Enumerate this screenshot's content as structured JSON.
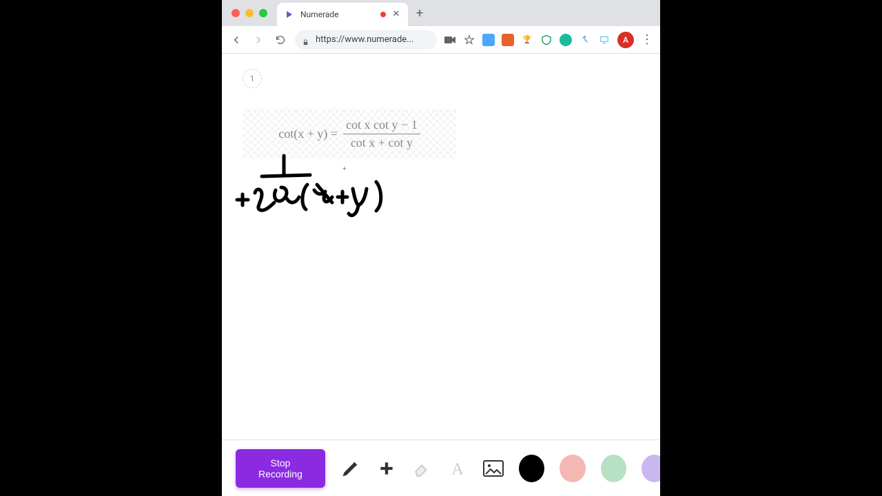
{
  "tab": {
    "title": "Numerade"
  },
  "address": {
    "url": "https://www.numerade..."
  },
  "avatar": {
    "letter": "A"
  },
  "page": {
    "badge": "1"
  },
  "formula": {
    "lhs": "cot(x + y) =",
    "num": "cot x cot y − 1",
    "den": "cot x + cot y"
  },
  "handwriting": {
    "numerator": "1",
    "denominator": "tan (x + y)"
  },
  "toolbar": {
    "stop_label": "Stop Recording",
    "colors": {
      "black": "#000000",
      "pink": "#f4b7b4",
      "green": "#b8e0c2",
      "purple": "#c9b8f0"
    }
  },
  "icons": {
    "video": "video-icon",
    "star": "star-icon"
  }
}
